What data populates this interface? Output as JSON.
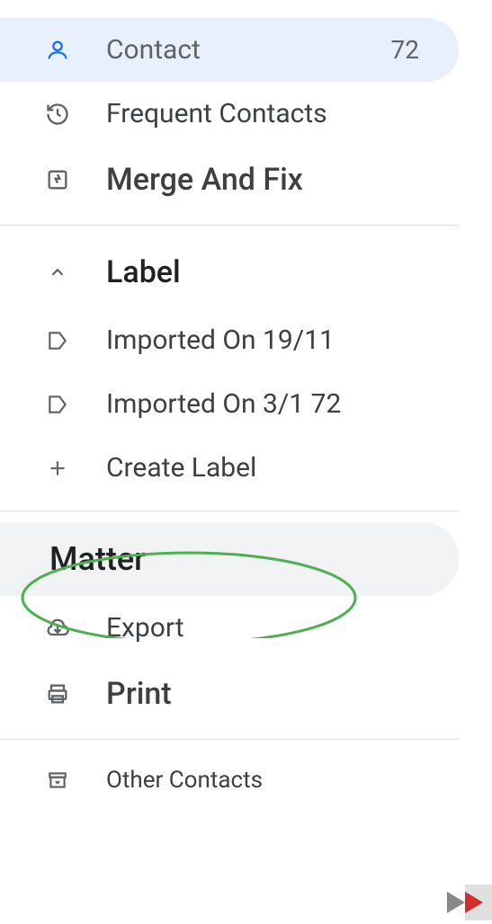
{
  "sidebar": {
    "contact": {
      "label": "Contact",
      "count": "72"
    },
    "frequent": {
      "label": "Frequent Contacts"
    },
    "merge": {
      "label": "Merge And Fix"
    },
    "labelSection": {
      "header": "Label",
      "items": [
        {
          "label": "Imported On 19/11"
        },
        {
          "label": "Imported On 3/1 72"
        }
      ],
      "create": "Create Label"
    },
    "matter": {
      "label": "Matter"
    },
    "export": {
      "label": "Export"
    },
    "print": {
      "label": "Print"
    },
    "other": {
      "label": "Other Contacts"
    }
  }
}
